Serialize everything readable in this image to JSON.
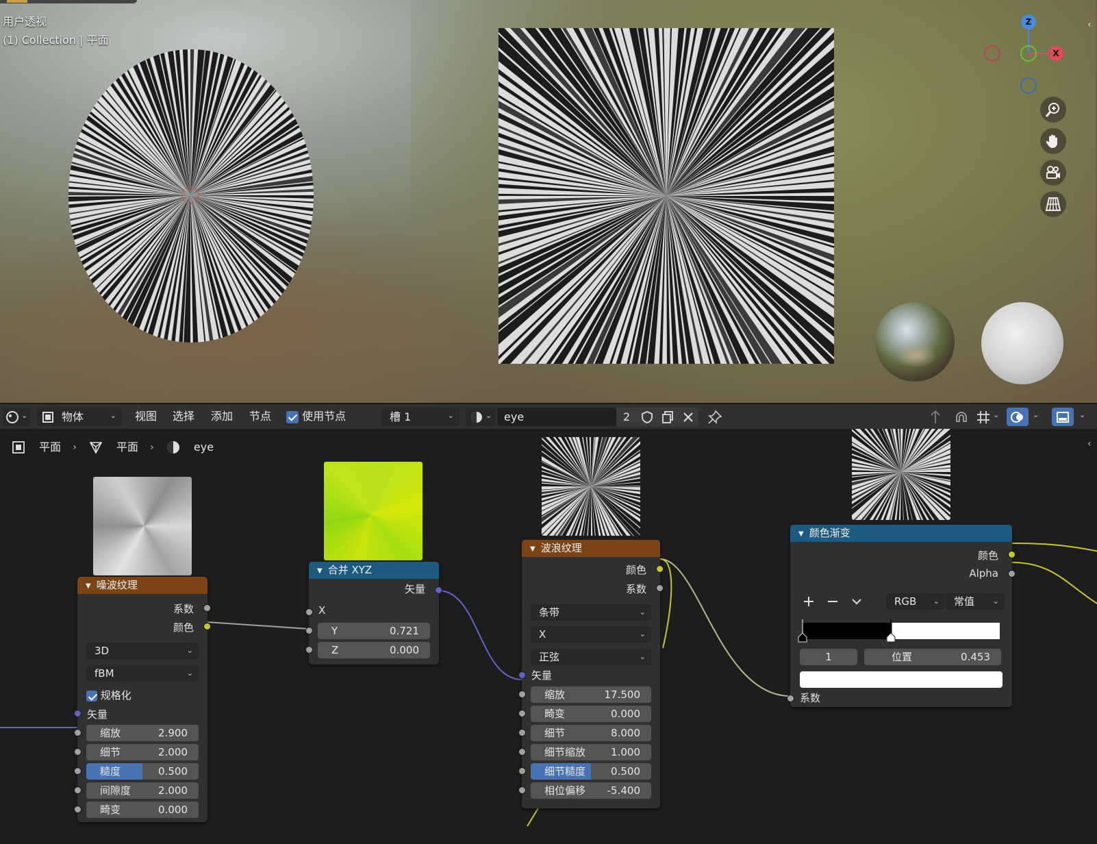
{
  "viewport": {
    "mode_label": "用户透视",
    "collection_label": "(1) Collection | 平面",
    "gizmo": {
      "z": "Z",
      "x": "X"
    },
    "nav_icons": [
      "zoom-icon",
      "pan-hand-icon",
      "camera-icon",
      "grid-icon"
    ]
  },
  "header": {
    "object_mode": "物体",
    "menu": {
      "view": "视图",
      "select": "选择",
      "add": "添加",
      "node": "节点"
    },
    "use_nodes": "使用节点",
    "slot": "槽 1",
    "material_name": "eye",
    "user_count": "2"
  },
  "breadcrumb": {
    "object": "平面",
    "mesh": "平面",
    "material": "eye"
  },
  "nodes": {
    "noise": {
      "title": "噪波纹理",
      "out_fac": "系数",
      "out_color": "颜色",
      "dimensions": "3D",
      "type": "fBM",
      "normalize": "规格化",
      "in_vector": "矢量",
      "fields": [
        {
          "label": "缩放",
          "value": "2.900"
        },
        {
          "label": "细节",
          "value": "2.000"
        },
        {
          "label": "糙度",
          "value": "0.500"
        },
        {
          "label": "间隙度",
          "value": "2.000"
        },
        {
          "label": "畸变",
          "value": "0.000"
        }
      ]
    },
    "combine": {
      "title": "合并 XYZ",
      "out_vector": "矢量",
      "in_x": "X",
      "y_label": "Y",
      "y_value": "0.721",
      "z_label": "Z",
      "z_value": "0.000"
    },
    "wave": {
      "title": "波浪纹理",
      "out_color": "颜色",
      "out_fac": "系数",
      "wave_type": "条带",
      "direction": "X",
      "profile": "正弦",
      "in_vector": "矢量",
      "fields": [
        {
          "label": "缩放",
          "value": "17.500"
        },
        {
          "label": "畸变",
          "value": "0.000"
        },
        {
          "label": "细节",
          "value": "8.000"
        },
        {
          "label": "细节缩放",
          "value": "1.000"
        },
        {
          "label": "细节糙度",
          "value": "0.500"
        },
        {
          "label": "相位偏移",
          "value": "-5.400"
        }
      ]
    },
    "ramp": {
      "title": "颜色渐变",
      "out_color": "颜色",
      "out_alpha": "Alpha",
      "color_mode": "RGB",
      "interpolation": "常值",
      "stop_index": "1",
      "pos_label": "位置",
      "pos_value": "0.453",
      "in_fac": "系数"
    }
  },
  "colors": {
    "accent": "#4772b3",
    "texture_header": "#7a4417",
    "converter_header": "#1d5a7f",
    "socket_color": "#c7c729",
    "socket_vector": "#6363c7",
    "socket_float": "#a1a1a1"
  }
}
